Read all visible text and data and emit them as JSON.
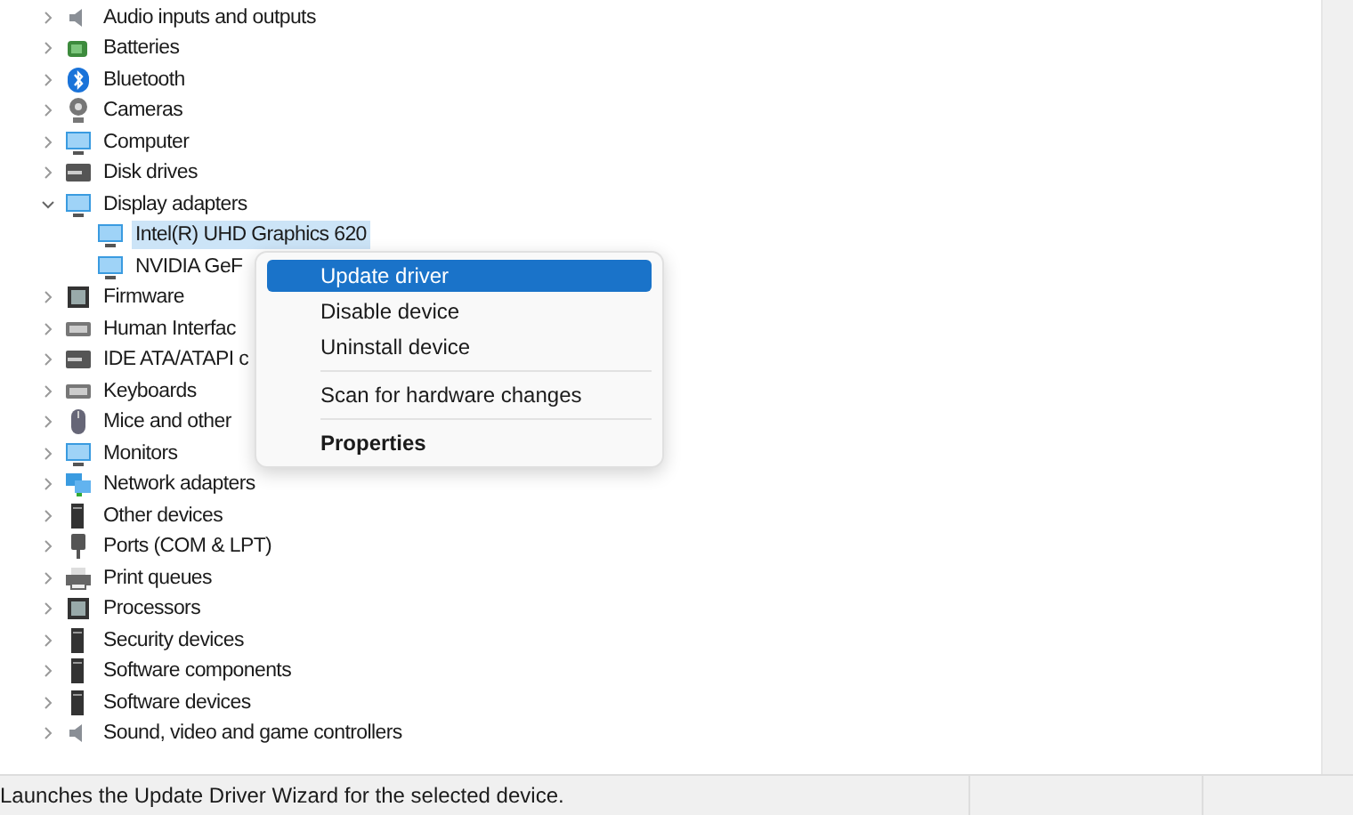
{
  "tree": [
    {
      "label": "Audio inputs and outputs",
      "expanded": false
    },
    {
      "label": "Batteries",
      "expanded": false
    },
    {
      "label": "Bluetooth",
      "expanded": false
    },
    {
      "label": "Cameras",
      "expanded": false
    },
    {
      "label": "Computer",
      "expanded": false
    },
    {
      "label": "Disk drives",
      "expanded": false
    },
    {
      "label": "Display adapters",
      "expanded": true,
      "children": [
        {
          "label": "Intel(R) UHD Graphics 620",
          "selected": true
        },
        {
          "label": "NVIDIA GeF",
          "selected": false
        }
      ]
    },
    {
      "label": "Firmware",
      "expanded": false
    },
    {
      "label": "Human Interfac",
      "expanded": false
    },
    {
      "label": "IDE ATA/ATAPI c",
      "expanded": false
    },
    {
      "label": "Keyboards",
      "expanded": false
    },
    {
      "label": "Mice and other",
      "expanded": false
    },
    {
      "label": "Monitors",
      "expanded": false
    },
    {
      "label": "Network adapters",
      "expanded": false
    },
    {
      "label": "Other devices",
      "expanded": false
    },
    {
      "label": "Ports (COM & LPT)",
      "expanded": false
    },
    {
      "label": "Print queues",
      "expanded": false
    },
    {
      "label": "Processors",
      "expanded": false
    },
    {
      "label": "Security devices",
      "expanded": false
    },
    {
      "label": "Software components",
      "expanded": false
    },
    {
      "label": "Software devices",
      "expanded": false
    },
    {
      "label": "Sound, video and game controllers",
      "expanded": false
    }
  ],
  "context_menu": {
    "groups": [
      [
        {
          "label": "Update driver",
          "selected": true,
          "default": false
        },
        {
          "label": "Disable device",
          "selected": false,
          "default": false
        },
        {
          "label": "Uninstall device",
          "selected": false,
          "default": false
        }
      ],
      [
        {
          "label": "Scan for hardware changes",
          "selected": false,
          "default": false
        }
      ],
      [
        {
          "label": "Properties",
          "selected": false,
          "default": true
        }
      ]
    ]
  },
  "status_bar": {
    "text": "Launches the Update Driver Wizard for the selected device."
  }
}
